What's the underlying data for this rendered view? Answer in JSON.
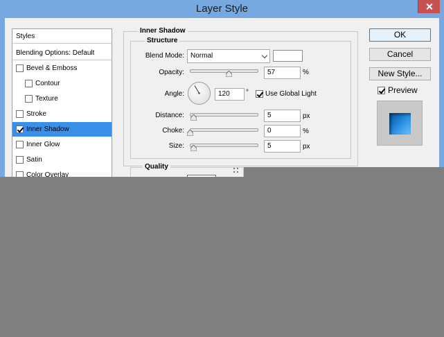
{
  "window": {
    "title": "Layer Style"
  },
  "styles_list": {
    "header": "Styles",
    "blending_options": "Blending Options: Default",
    "items": [
      {
        "label": "Bevel & Emboss",
        "checked": false
      },
      {
        "label": "Contour",
        "checked": false
      },
      {
        "label": "Texture",
        "checked": false
      },
      {
        "label": "Stroke",
        "checked": false
      },
      {
        "label": "Inner Shadow",
        "checked": true,
        "selected": true
      },
      {
        "label": "Inner Glow",
        "checked": false
      },
      {
        "label": "Satin",
        "checked": false
      },
      {
        "label": "Color Overlay",
        "checked": false
      }
    ]
  },
  "inner_shadow": {
    "section_title": "Inner Shadow",
    "structure_title": "Structure",
    "blend_mode_label": "Blend Mode:",
    "blend_mode_value": "Normal",
    "shadow_color": "#ffffff",
    "opacity_label": "Opacity:",
    "opacity_value": "57",
    "opacity_unit": "%",
    "opacity_fraction": 0.57,
    "angle_label": "Angle:",
    "angle_value": "120",
    "angle_unit": "°",
    "use_global_light_label": "Use Global Light",
    "use_global_light": true,
    "distance_label": "Distance:",
    "distance_value": "5",
    "distance_unit": "px",
    "choke_label": "Choke:",
    "choke_value": "0",
    "choke_unit": "%",
    "size_label": "Size:",
    "size_value": "5",
    "size_unit": "px",
    "quality_title": "Quality"
  },
  "buttons": {
    "ok": "OK",
    "cancel": "Cancel",
    "new_style": "New Style...",
    "preview_label": "Preview",
    "preview_checked": true
  },
  "colors": {
    "title_bar": "#78a8e0",
    "selection": "#3b8fe8",
    "close_button": "#c75050"
  },
  "icons": [
    "close-icon",
    "checkbox-icon",
    "dropdown-arrow-icon",
    "slider-thumb-icon",
    "angle-dial-icon",
    "resize-grip-icon"
  ]
}
